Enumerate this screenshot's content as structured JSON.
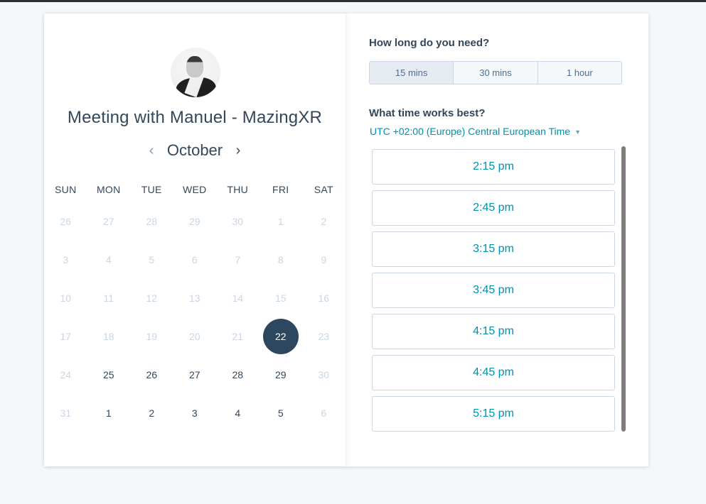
{
  "meeting": {
    "title": "Meeting with Manuel - MazingXR",
    "avatar_alt": "Manuel profile photo"
  },
  "calendar": {
    "month": "October",
    "prev_icon": "‹",
    "next_icon": "›",
    "weekdays": [
      "SUN",
      "MON",
      "TUE",
      "WED",
      "THU",
      "FRI",
      "SAT"
    ],
    "weeks": [
      [
        {
          "d": "26",
          "s": "disabled"
        },
        {
          "d": "27",
          "s": "disabled"
        },
        {
          "d": "28",
          "s": "disabled"
        },
        {
          "d": "29",
          "s": "disabled"
        },
        {
          "d": "30",
          "s": "disabled"
        },
        {
          "d": "1",
          "s": "disabled"
        },
        {
          "d": "2",
          "s": "disabled"
        }
      ],
      [
        {
          "d": "3",
          "s": "disabled"
        },
        {
          "d": "4",
          "s": "disabled"
        },
        {
          "d": "5",
          "s": "disabled"
        },
        {
          "d": "6",
          "s": "disabled"
        },
        {
          "d": "7",
          "s": "disabled"
        },
        {
          "d": "8",
          "s": "disabled"
        },
        {
          "d": "9",
          "s": "disabled"
        }
      ],
      [
        {
          "d": "10",
          "s": "disabled"
        },
        {
          "d": "11",
          "s": "disabled"
        },
        {
          "d": "12",
          "s": "disabled"
        },
        {
          "d": "13",
          "s": "disabled"
        },
        {
          "d": "14",
          "s": "disabled"
        },
        {
          "d": "15",
          "s": "disabled"
        },
        {
          "d": "16",
          "s": "disabled"
        }
      ],
      [
        {
          "d": "17",
          "s": "disabled"
        },
        {
          "d": "18",
          "s": "disabled"
        },
        {
          "d": "19",
          "s": "disabled"
        },
        {
          "d": "20",
          "s": "disabled"
        },
        {
          "d": "21",
          "s": "disabled"
        },
        {
          "d": "22",
          "s": "selected"
        },
        {
          "d": "23",
          "s": "disabled"
        }
      ],
      [
        {
          "d": "24",
          "s": "disabled"
        },
        {
          "d": "25",
          "s": "available"
        },
        {
          "d": "26",
          "s": "available"
        },
        {
          "d": "27",
          "s": "available"
        },
        {
          "d": "28",
          "s": "available"
        },
        {
          "d": "29",
          "s": "available"
        },
        {
          "d": "30",
          "s": "disabled"
        }
      ],
      [
        {
          "d": "31",
          "s": "disabled"
        },
        {
          "d": "1",
          "s": "available"
        },
        {
          "d": "2",
          "s": "available"
        },
        {
          "d": "3",
          "s": "available"
        },
        {
          "d": "4",
          "s": "available"
        },
        {
          "d": "5",
          "s": "available"
        },
        {
          "d": "6",
          "s": "disabled"
        }
      ]
    ],
    "selected_day": "22"
  },
  "duration": {
    "question": "How long do you need?",
    "options": [
      "15 mins",
      "30 mins",
      "1 hour"
    ],
    "selected": "15 mins"
  },
  "time": {
    "question": "What time works best?",
    "timezone": "UTC +02:00 (Europe) Central European Time",
    "timezone_caret": "▼",
    "slots": [
      "2:15 pm",
      "2:45 pm",
      "3:15 pm",
      "3:45 pm",
      "4:15 pm",
      "4:45 pm",
      "5:15 pm"
    ]
  },
  "colors": {
    "accent": "#0091ae",
    "selected_day": "#2d4760",
    "text": "#33475b",
    "disabled": "#cbd6e2"
  }
}
